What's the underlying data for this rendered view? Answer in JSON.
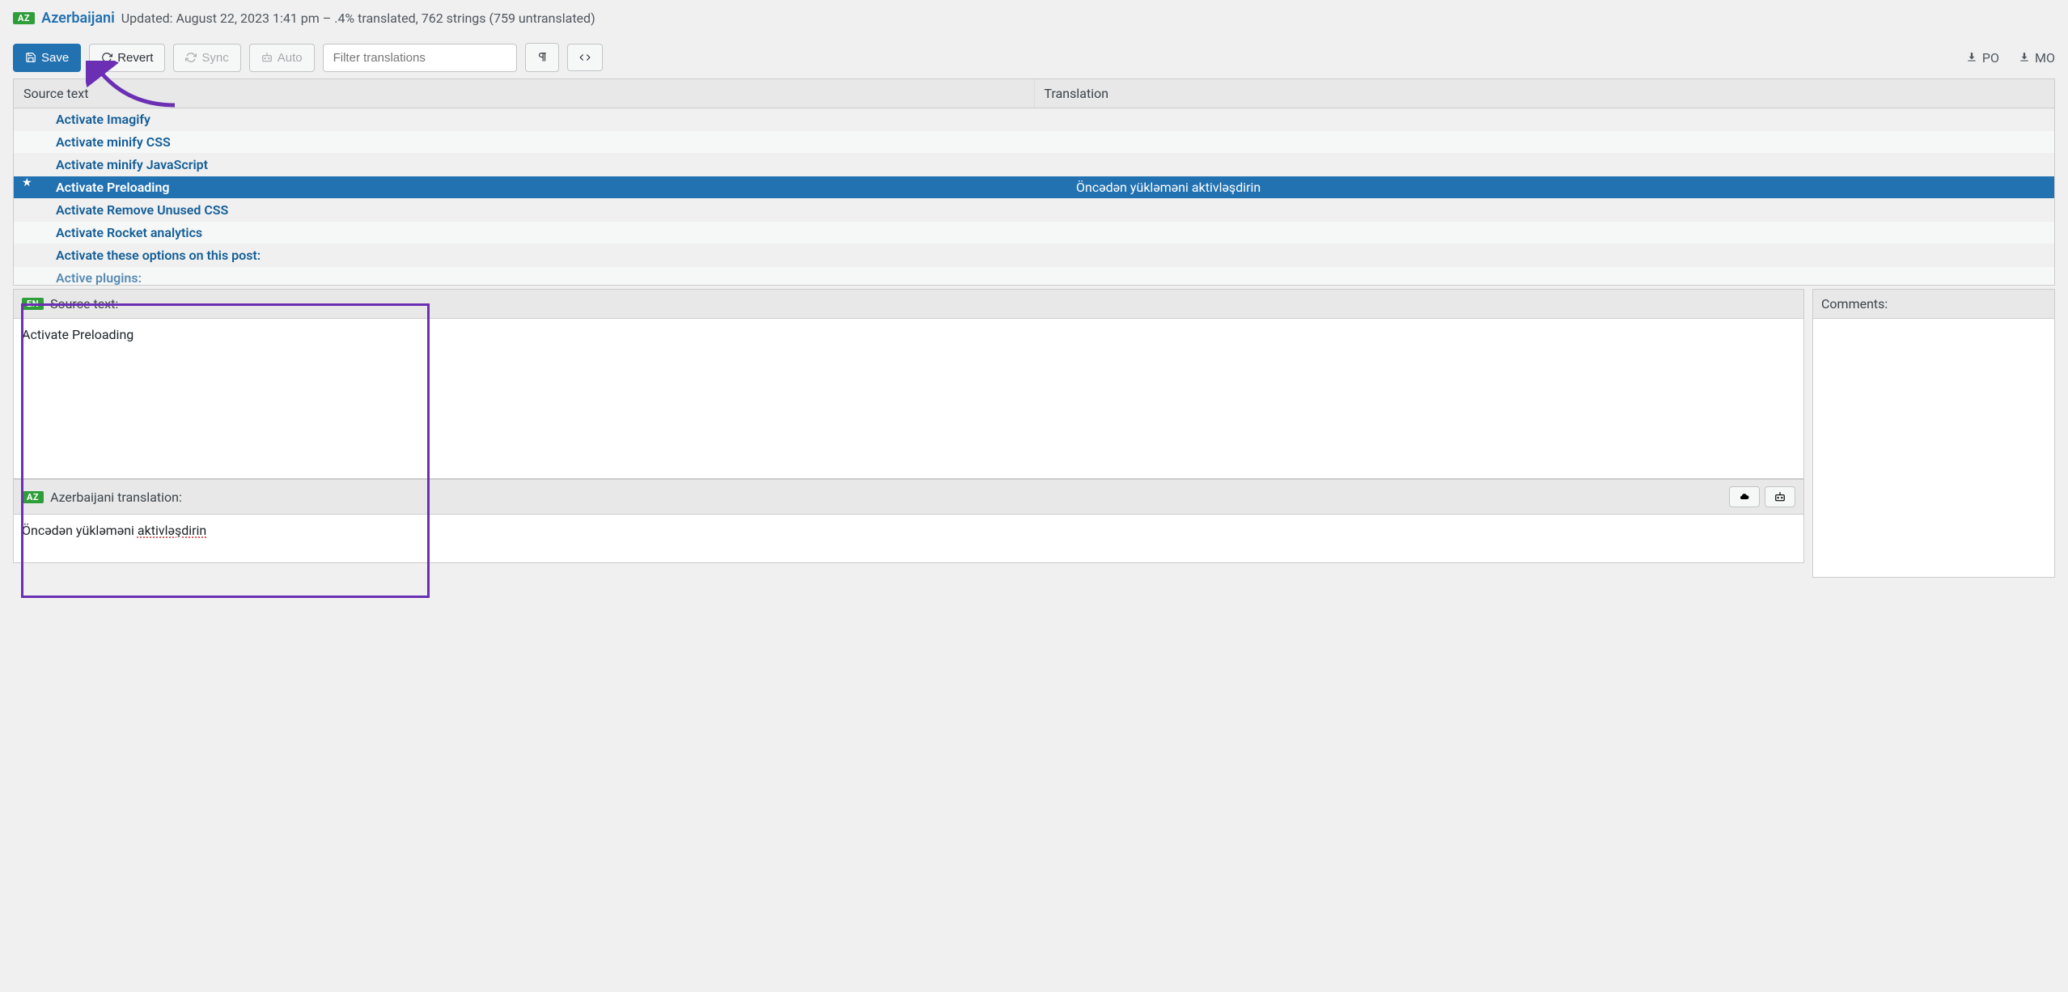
{
  "header": {
    "langCode": "AZ",
    "langName": "Azerbaijani",
    "subtitle": "Updated: August 22, 2023 1:41 pm – .4% translated, 762 strings (759 untranslated)"
  },
  "toolbar": {
    "save": "Save",
    "revert": "Revert",
    "sync": "Sync",
    "auto": "Auto",
    "filter_placeholder": "Filter translations",
    "po": "PO",
    "mo": "MO"
  },
  "table": {
    "source_header": "Source text",
    "trans_header": "Translation",
    "rows": [
      {
        "source": "Activate Imagify",
        "translation": ""
      },
      {
        "source": "Activate minify CSS",
        "translation": ""
      },
      {
        "source": "Activate minify JavaScript",
        "translation": ""
      },
      {
        "source": "Activate Preloading",
        "translation": "Öncədən yükləməni aktivləşdirin",
        "selected": true
      },
      {
        "source": "Activate Remove Unused CSS",
        "translation": ""
      },
      {
        "source": "Activate Rocket analytics",
        "translation": ""
      },
      {
        "source": "Activate these options on this post:",
        "translation": ""
      },
      {
        "source": "Active plugins:",
        "translation": ""
      }
    ]
  },
  "editor": {
    "source_badge": "EN",
    "source_label": "Source text:",
    "source_text": "Activate Preloading",
    "target_badge": "AZ",
    "target_label": "Azerbaijani translation:",
    "target_text_prefix": "Öncədən yükləməni ",
    "target_text_wavy": "aktivləşdirin",
    "comments_label": "Comments:"
  }
}
